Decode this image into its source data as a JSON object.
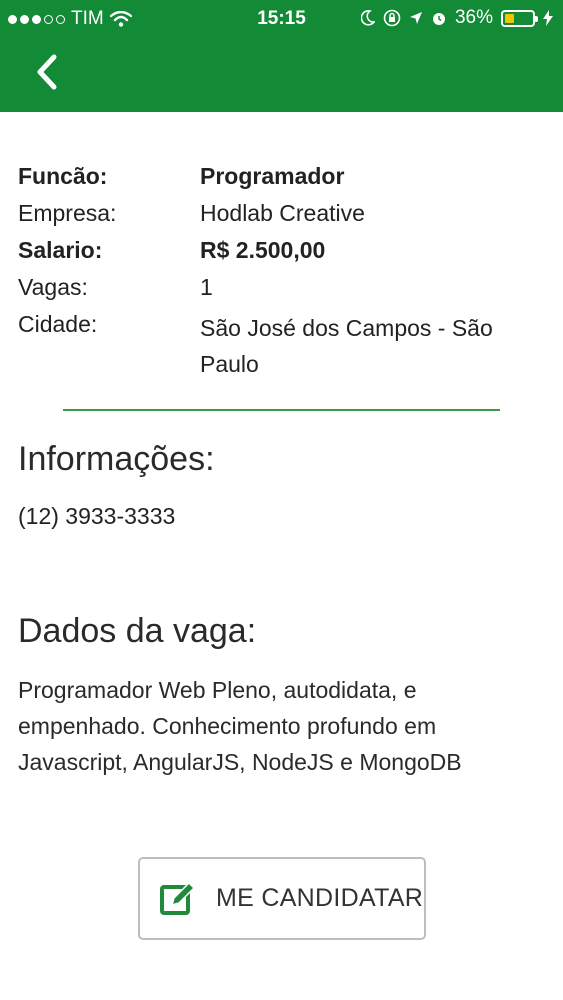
{
  "status_bar": {
    "carrier": "TIM",
    "time": "15:15",
    "battery_percent": "36%",
    "battery_level": 0.36,
    "signal_bars_filled": 3,
    "signal_bars_total": 5
  },
  "header": {
    "background_color": "#138a36",
    "back_icon": "chevron-left-icon"
  },
  "job": {
    "function_label": "Funcão:",
    "function_value": "Programador",
    "company_label": "Empresa:",
    "company_value": "Hodlab Creative",
    "salary_label": "Salario:",
    "salary_value": "R$ 2.500,00",
    "openings_label": "Vagas:",
    "openings_value": "1",
    "city_label": "Cidade:",
    "city_value": "São José dos Campos - São Paulo"
  },
  "info": {
    "title": "Informações:",
    "phone": "(12) 3933-3333"
  },
  "vaga": {
    "title": "Dados da vaga:",
    "description": "Programador Web Pleno, autodidata, e empenhado. Conhecimento profundo em Javascript, AngularJS, NodeJS e MongoDB"
  },
  "apply": {
    "label": "ME CANDIDATAR",
    "icon": "edit-icon",
    "icon_color": "#1f8a3a"
  }
}
